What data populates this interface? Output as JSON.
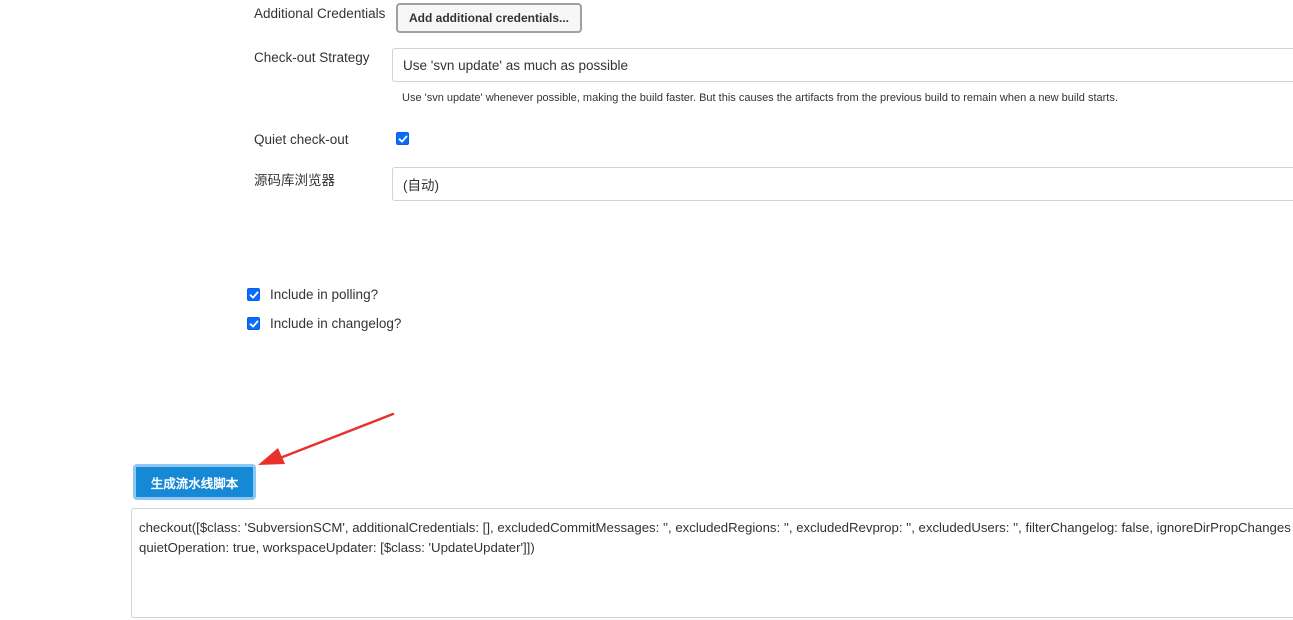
{
  "additional_credentials": {
    "label": "Additional Credentials",
    "button_label": "Add additional credentials..."
  },
  "checkout_strategy": {
    "label": "Check-out Strategy",
    "value": "Use 'svn update' as much as possible",
    "help": "Use 'svn update' whenever possible, making the build faster. But this causes the artifacts from the previous build to remain when a new build starts."
  },
  "quiet_checkout": {
    "label": "Quiet check-out",
    "checked": true
  },
  "repo_browser": {
    "label": "源码库浏览器",
    "value": "(自动)"
  },
  "include_polling": {
    "label": "Include in polling?",
    "checked": true
  },
  "include_changelog": {
    "label": "Include in changelog?",
    "checked": true
  },
  "generate_button": {
    "label": "生成流水线脚本"
  },
  "script_output": {
    "line1": "checkout([$class: 'SubversionSCM', additionalCredentials: [], excludedCommitMessages: '', excludedRegions: '', excludedRevprop: '', excludedUsers: '', filterChangelog: false, ignoreDirPropChanges",
    "line2": "quietOperation: true, workspaceUpdater: [$class: 'UpdateUpdater']])"
  },
  "colors": {
    "primary_button": "#1589d6",
    "checkbox": "#0a6cff",
    "annotation_arrow": "#e8312a"
  }
}
